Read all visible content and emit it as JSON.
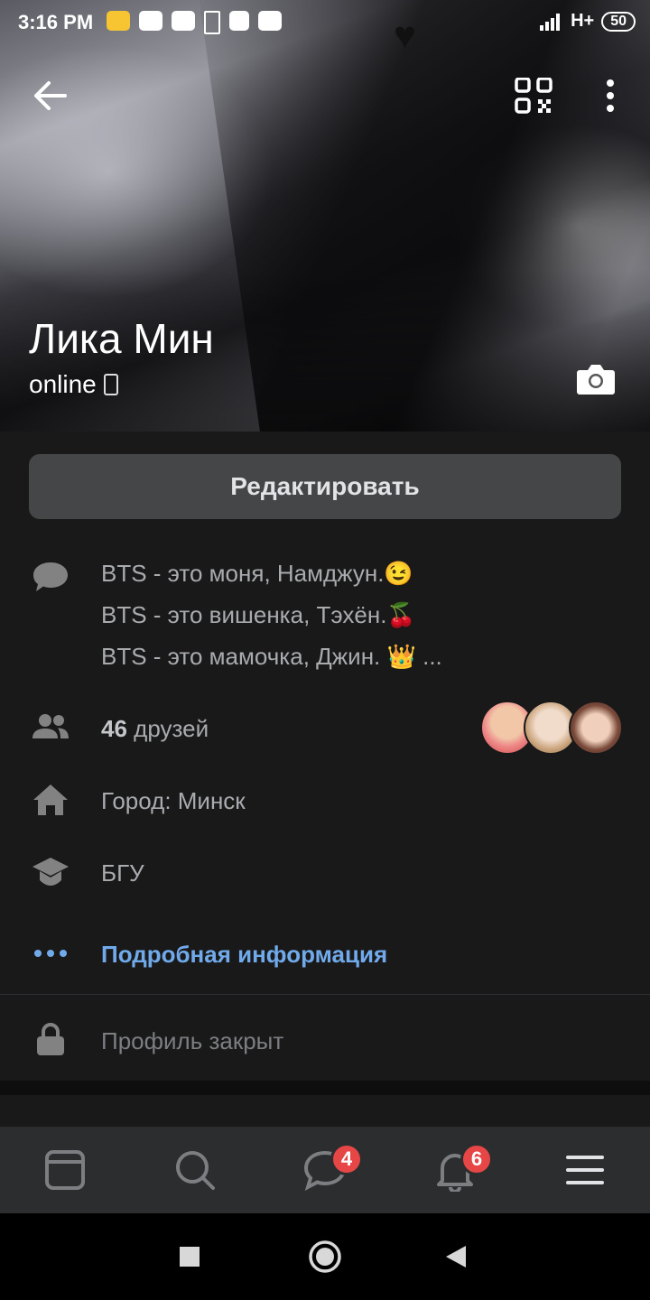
{
  "status_bar": {
    "time": "3:16 PM",
    "network": "H+",
    "battery": "50"
  },
  "profile": {
    "name": "Лика Мин",
    "status": "online",
    "edit_label": "Редактировать"
  },
  "about": {
    "lines": [
      "BTS - это моня, Намджун.😉",
      "BTS - это вишенка, Тэхён.🍒",
      "BTS - это мамочка, Джин. 👑 ..."
    ]
  },
  "friends": {
    "count": "46",
    "label": " друзей"
  },
  "city": "Город: Минск",
  "education": "БГУ",
  "more_info": "Подробная информация",
  "privacy": "Профиль закрыт",
  "tabbar": {
    "messages_badge": "4",
    "notifications_badge": "6"
  },
  "colors": {
    "background": "#19191a",
    "accent_link": "#71aaeb",
    "badge": "#e64646",
    "button": "#454647"
  }
}
